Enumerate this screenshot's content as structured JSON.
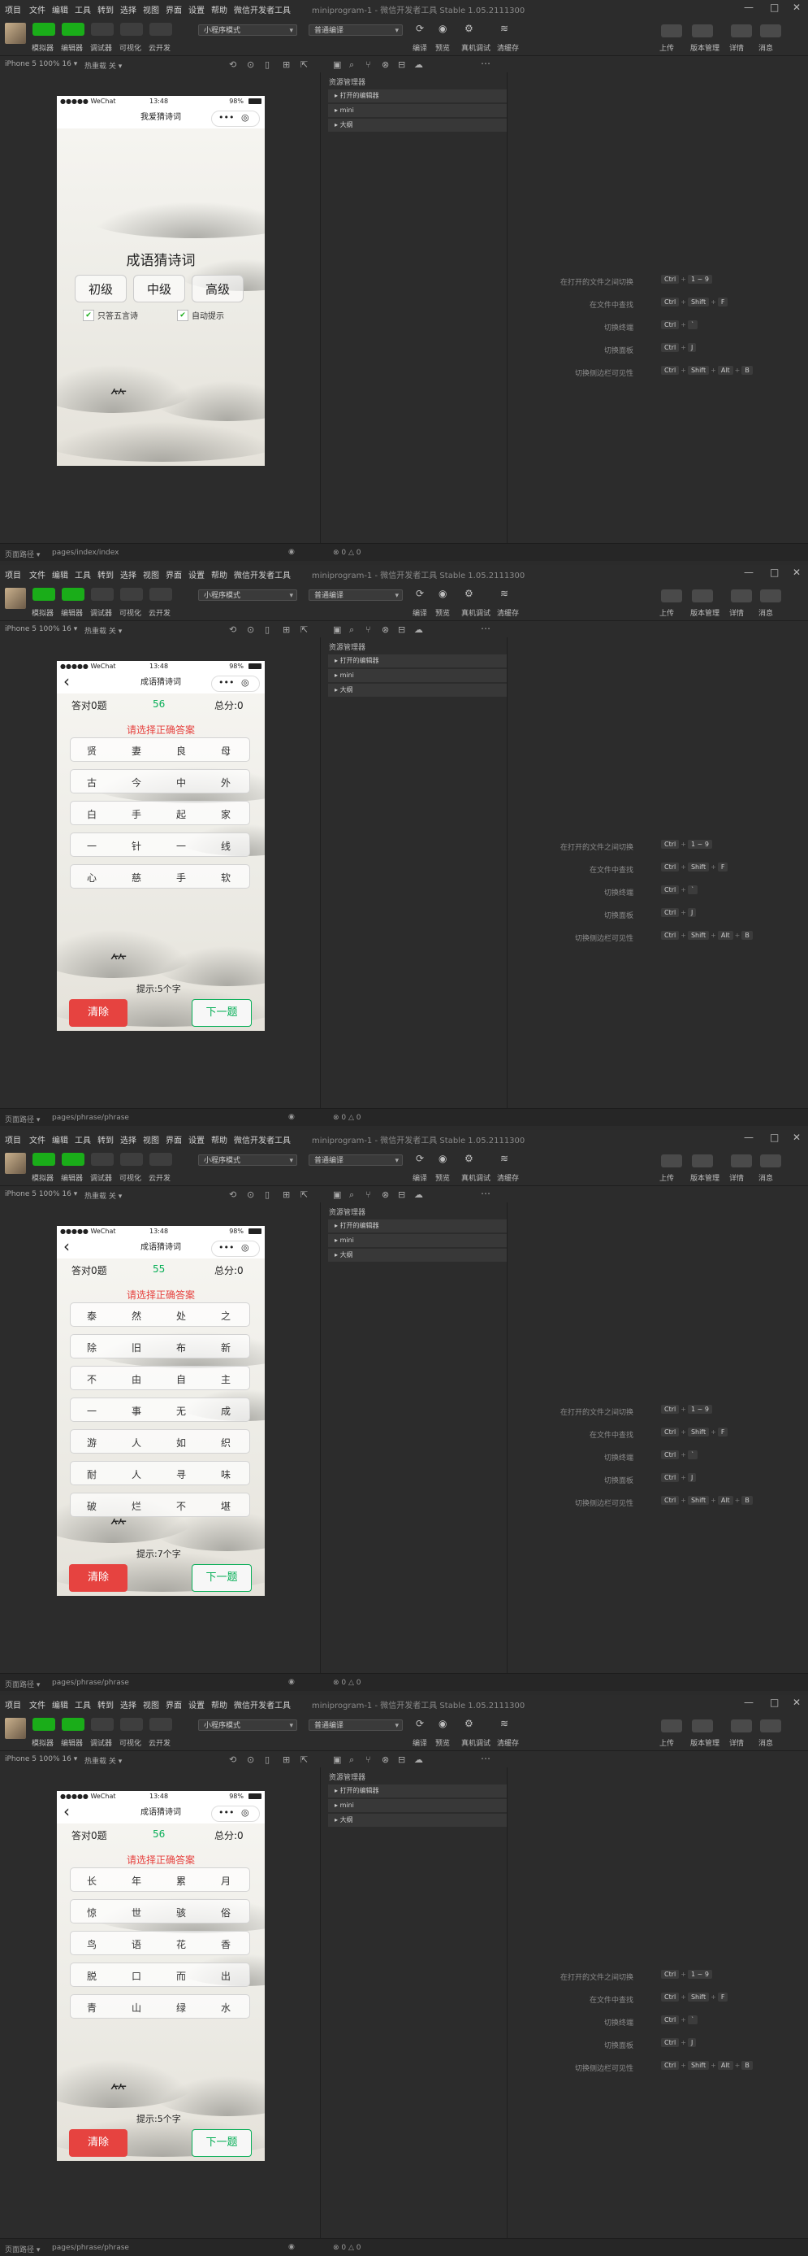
{
  "menu": [
    "项目",
    "文件",
    "编辑",
    "工具",
    "转到",
    "选择",
    "视图",
    "界面",
    "设置",
    "帮助",
    "微信开发者工具"
  ],
  "window_title": "miniprogram-1 - 微信开发者工具 Stable 1.05.2111300",
  "toolbar": {
    "simulator": "模拟器",
    "editor": "编辑器",
    "debugger": "调试器",
    "visualize": "可视化",
    "cloud": "云开发",
    "mode": "小程序模式",
    "compile_mode": "普通编译",
    "compile": "编译",
    "preview": "预览",
    "real_debug": "真机调试",
    "clear_cache": "清缓存",
    "upload": "上传",
    "version": "版本管理",
    "details": "详情",
    "message": "消息"
  },
  "device": "iPhone 5 100% 16 ▾",
  "hot_reload": "热重载 关 ▾",
  "explorer": {
    "title": "资源管理器",
    "items": [
      "打开的编辑器",
      "mini",
      "大纲"
    ]
  },
  "shortcuts": [
    {
      "label": "在打开的文件之间切换",
      "keys": [
        "Ctrl",
        "1 ~ 9"
      ]
    },
    {
      "label": "在文件中查找",
      "keys": [
        "Ctrl",
        "Shift",
        "F"
      ]
    },
    {
      "label": "切换终端",
      "keys": [
        "Ctrl",
        "`"
      ]
    },
    {
      "label": "切换面板",
      "keys": [
        "Ctrl",
        "J"
      ]
    },
    {
      "label": "切换侧边栏可见性",
      "keys": [
        "Ctrl",
        "Shift",
        "Alt",
        "B"
      ]
    }
  ],
  "status": {
    "carrier": "●●●●● WeChat",
    "time": "13:48",
    "battery": "98%",
    "capsule_dots": "•••",
    "capsule_target": "◎"
  },
  "screens": [
    {
      "type": "home",
      "path": "pages/index/index",
      "nav_title": "我爱猜诗词",
      "heading": "成语猜诗词",
      "levels": [
        "初级",
        "中级",
        "高级"
      ],
      "options": [
        "只答五言诗",
        "自动提示"
      ],
      "errors": "⊗ 0 △ 0",
      "page_path_label": "页面路径 ▾"
    },
    {
      "type": "game",
      "path": "pages/phrase/phrase",
      "nav_title": "成语猜诗词",
      "answered": "答对0题",
      "timer": "56",
      "score": "总分:0",
      "prompt": "请选择正确答案",
      "rows": [
        [
          "贤",
          "妻",
          "良",
          "母"
        ],
        [
          "古",
          "今",
          "中",
          "外"
        ],
        [
          "白",
          "手",
          "起",
          "家"
        ],
        [
          "一",
          "针",
          "一",
          "线"
        ],
        [
          "心",
          "慈",
          "手",
          "软"
        ]
      ],
      "hint": "提示:5个字",
      "clear": "清除",
      "next": "下一题",
      "errors": "⊗ 0 △ 0",
      "page_path_label": "页面路径 ▾"
    },
    {
      "type": "game",
      "path": "pages/phrase/phrase",
      "nav_title": "成语猜诗词",
      "answered": "答对0题",
      "timer": "55",
      "score": "总分:0",
      "prompt": "请选择正确答案",
      "rows": [
        [
          "泰",
          "然",
          "处",
          "之"
        ],
        [
          "除",
          "旧",
          "布",
          "新"
        ],
        [
          "不",
          "由",
          "自",
          "主"
        ],
        [
          "一",
          "事",
          "无",
          "成"
        ],
        [
          "游",
          "人",
          "如",
          "织"
        ],
        [
          "耐",
          "人",
          "寻",
          "味"
        ],
        [
          "破",
          "烂",
          "不",
          "堪"
        ]
      ],
      "hint": "提示:7个字",
      "clear": "清除",
      "next": "下一题",
      "errors": "⊗ 0 △ 0",
      "page_path_label": "页面路径 ▾"
    },
    {
      "type": "game",
      "path": "pages/phrase/phrase",
      "nav_title": "成语猜诗词",
      "answered": "答对0题",
      "timer": "56",
      "score": "总分:0",
      "prompt": "请选择正确答案",
      "rows": [
        [
          "长",
          "年",
          "累",
          "月"
        ],
        [
          "惊",
          "世",
          "骇",
          "俗"
        ],
        [
          "鸟",
          "语",
          "花",
          "香"
        ],
        [
          "脱",
          "口",
          "而",
          "出"
        ],
        [
          "青",
          "山",
          "绿",
          "水"
        ]
      ],
      "hint": "提示:5个字",
      "clear": "清除",
      "next": "下一题",
      "errors": "⊗ 0 △ 0",
      "page_path_label": "页面路径 ▾"
    }
  ],
  "colors": {
    "accent_green": "#1aad19",
    "red": "#e64340",
    "next_green": "#06ae56"
  },
  "icons": [
    "compile-icon",
    "preview-icon",
    "real-debug-icon",
    "clear-cache-icon",
    "upload-icon",
    "version-icon",
    "details-icon",
    "message-icon",
    "back-icon"
  ]
}
